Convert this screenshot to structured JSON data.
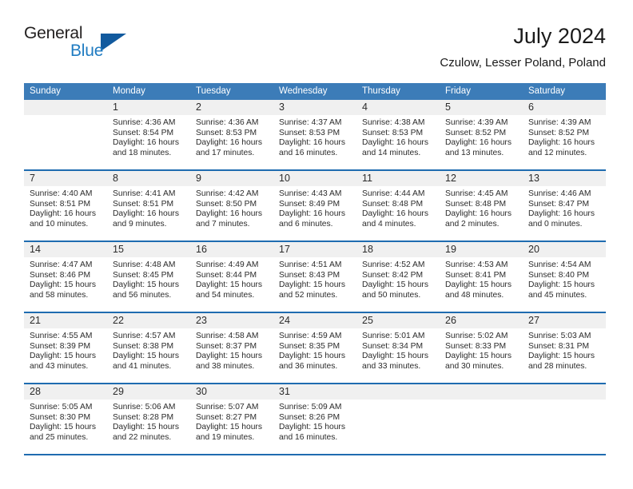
{
  "brand": {
    "name_part1": "General",
    "name_part2": "Blue",
    "triangle_color": "#125a9e",
    "blue_color": "#1f7bc1"
  },
  "header": {
    "title": "July 2024",
    "location": "Czulow, Lesser Poland, Poland"
  },
  "theme": {
    "header_row_bg": "#3c7cb8",
    "row_separator": "#1f6cb0",
    "day_band_bg": "#f0f0f0",
    "text_color": "#2b2b2b"
  },
  "weekdays": [
    "Sunday",
    "Monday",
    "Tuesday",
    "Wednesday",
    "Thursday",
    "Friday",
    "Saturday"
  ],
  "weeks": [
    [
      {
        "day": "",
        "lines": []
      },
      {
        "day": "1",
        "lines": [
          "Sunrise: 4:36 AM",
          "Sunset: 8:54 PM",
          "Daylight: 16 hours",
          "and 18 minutes."
        ]
      },
      {
        "day": "2",
        "lines": [
          "Sunrise: 4:36 AM",
          "Sunset: 8:53 PM",
          "Daylight: 16 hours",
          "and 17 minutes."
        ]
      },
      {
        "day": "3",
        "lines": [
          "Sunrise: 4:37 AM",
          "Sunset: 8:53 PM",
          "Daylight: 16 hours",
          "and 16 minutes."
        ]
      },
      {
        "day": "4",
        "lines": [
          "Sunrise: 4:38 AM",
          "Sunset: 8:53 PM",
          "Daylight: 16 hours",
          "and 14 minutes."
        ]
      },
      {
        "day": "5",
        "lines": [
          "Sunrise: 4:39 AM",
          "Sunset: 8:52 PM",
          "Daylight: 16 hours",
          "and 13 minutes."
        ]
      },
      {
        "day": "6",
        "lines": [
          "Sunrise: 4:39 AM",
          "Sunset: 8:52 PM",
          "Daylight: 16 hours",
          "and 12 minutes."
        ]
      }
    ],
    [
      {
        "day": "7",
        "lines": [
          "Sunrise: 4:40 AM",
          "Sunset: 8:51 PM",
          "Daylight: 16 hours",
          "and 10 minutes."
        ]
      },
      {
        "day": "8",
        "lines": [
          "Sunrise: 4:41 AM",
          "Sunset: 8:51 PM",
          "Daylight: 16 hours",
          "and 9 minutes."
        ]
      },
      {
        "day": "9",
        "lines": [
          "Sunrise: 4:42 AM",
          "Sunset: 8:50 PM",
          "Daylight: 16 hours",
          "and 7 minutes."
        ]
      },
      {
        "day": "10",
        "lines": [
          "Sunrise: 4:43 AM",
          "Sunset: 8:49 PM",
          "Daylight: 16 hours",
          "and 6 minutes."
        ]
      },
      {
        "day": "11",
        "lines": [
          "Sunrise: 4:44 AM",
          "Sunset: 8:48 PM",
          "Daylight: 16 hours",
          "and 4 minutes."
        ]
      },
      {
        "day": "12",
        "lines": [
          "Sunrise: 4:45 AM",
          "Sunset: 8:48 PM",
          "Daylight: 16 hours",
          "and 2 minutes."
        ]
      },
      {
        "day": "13",
        "lines": [
          "Sunrise: 4:46 AM",
          "Sunset: 8:47 PM",
          "Daylight: 16 hours",
          "and 0 minutes."
        ]
      }
    ],
    [
      {
        "day": "14",
        "lines": [
          "Sunrise: 4:47 AM",
          "Sunset: 8:46 PM",
          "Daylight: 15 hours",
          "and 58 minutes."
        ]
      },
      {
        "day": "15",
        "lines": [
          "Sunrise: 4:48 AM",
          "Sunset: 8:45 PM",
          "Daylight: 15 hours",
          "and 56 minutes."
        ]
      },
      {
        "day": "16",
        "lines": [
          "Sunrise: 4:49 AM",
          "Sunset: 8:44 PM",
          "Daylight: 15 hours",
          "and 54 minutes."
        ]
      },
      {
        "day": "17",
        "lines": [
          "Sunrise: 4:51 AM",
          "Sunset: 8:43 PM",
          "Daylight: 15 hours",
          "and 52 minutes."
        ]
      },
      {
        "day": "18",
        "lines": [
          "Sunrise: 4:52 AM",
          "Sunset: 8:42 PM",
          "Daylight: 15 hours",
          "and 50 minutes."
        ]
      },
      {
        "day": "19",
        "lines": [
          "Sunrise: 4:53 AM",
          "Sunset: 8:41 PM",
          "Daylight: 15 hours",
          "and 48 minutes."
        ]
      },
      {
        "day": "20",
        "lines": [
          "Sunrise: 4:54 AM",
          "Sunset: 8:40 PM",
          "Daylight: 15 hours",
          "and 45 minutes."
        ]
      }
    ],
    [
      {
        "day": "21",
        "lines": [
          "Sunrise: 4:55 AM",
          "Sunset: 8:39 PM",
          "Daylight: 15 hours",
          "and 43 minutes."
        ]
      },
      {
        "day": "22",
        "lines": [
          "Sunrise: 4:57 AM",
          "Sunset: 8:38 PM",
          "Daylight: 15 hours",
          "and 41 minutes."
        ]
      },
      {
        "day": "23",
        "lines": [
          "Sunrise: 4:58 AM",
          "Sunset: 8:37 PM",
          "Daylight: 15 hours",
          "and 38 minutes."
        ]
      },
      {
        "day": "24",
        "lines": [
          "Sunrise: 4:59 AM",
          "Sunset: 8:35 PM",
          "Daylight: 15 hours",
          "and 36 minutes."
        ]
      },
      {
        "day": "25",
        "lines": [
          "Sunrise: 5:01 AM",
          "Sunset: 8:34 PM",
          "Daylight: 15 hours",
          "and 33 minutes."
        ]
      },
      {
        "day": "26",
        "lines": [
          "Sunrise: 5:02 AM",
          "Sunset: 8:33 PM",
          "Daylight: 15 hours",
          "and 30 minutes."
        ]
      },
      {
        "day": "27",
        "lines": [
          "Sunrise: 5:03 AM",
          "Sunset: 8:31 PM",
          "Daylight: 15 hours",
          "and 28 minutes."
        ]
      }
    ],
    [
      {
        "day": "28",
        "lines": [
          "Sunrise: 5:05 AM",
          "Sunset: 8:30 PM",
          "Daylight: 15 hours",
          "and 25 minutes."
        ]
      },
      {
        "day": "29",
        "lines": [
          "Sunrise: 5:06 AM",
          "Sunset: 8:28 PM",
          "Daylight: 15 hours",
          "and 22 minutes."
        ]
      },
      {
        "day": "30",
        "lines": [
          "Sunrise: 5:07 AM",
          "Sunset: 8:27 PM",
          "Daylight: 15 hours",
          "and 19 minutes."
        ]
      },
      {
        "day": "31",
        "lines": [
          "Sunrise: 5:09 AM",
          "Sunset: 8:26 PM",
          "Daylight: 15 hours",
          "and 16 minutes."
        ]
      },
      {
        "day": "",
        "lines": []
      },
      {
        "day": "",
        "lines": []
      },
      {
        "day": "",
        "lines": []
      }
    ]
  ]
}
